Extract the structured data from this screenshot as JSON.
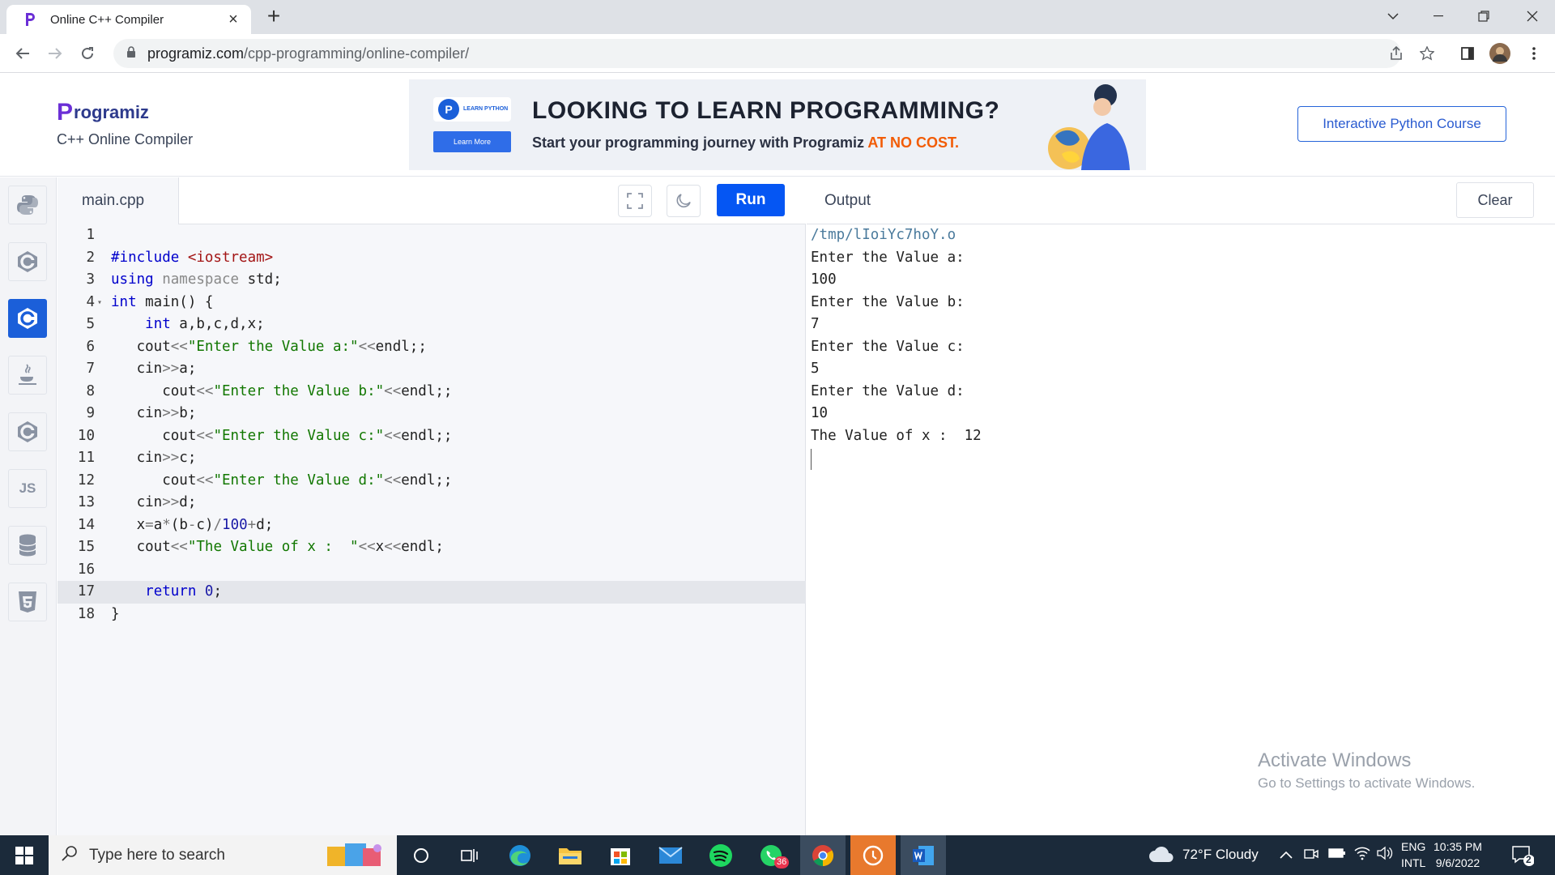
{
  "browser": {
    "tab_title": "Online C++ Compiler",
    "url_domain": "programiz.com",
    "url_path": "/cpp-programming/online-compiler/"
  },
  "header": {
    "logo_text": "rogramiz",
    "logo_mark": "P",
    "subtitle": "C++ Online Compiler",
    "banner": {
      "badge_text": "LEARN PYTHON",
      "learn_more": "Learn More",
      "headline": "LOOKING TO LEARN PROGRAMMING?",
      "sub_text": "Start your programming journey with Programiz ",
      "sub_highlight": "AT NO COST."
    },
    "course_button": "Interactive Python Course"
  },
  "rail": {
    "items": [
      {
        "name": "python",
        "icon": "python-icon"
      },
      {
        "name": "c",
        "icon": "c-icon",
        "glyph": "C"
      },
      {
        "name": "cpp",
        "icon": "cpp-icon",
        "glyph": "C",
        "active": true
      },
      {
        "name": "java",
        "icon": "java-icon",
        "glyph": "♨"
      },
      {
        "name": "csharp",
        "icon": "csharp-icon",
        "glyph": "C"
      },
      {
        "name": "javascript",
        "icon": "js-icon",
        "glyph": "JS"
      },
      {
        "name": "sql",
        "icon": "database-icon"
      },
      {
        "name": "html",
        "icon": "html5-icon",
        "glyph": "5"
      }
    ]
  },
  "editor": {
    "file_name": "main.cpp",
    "run_label": "Run",
    "current_line": 17,
    "lines": [
      {
        "n": "1",
        "code": ""
      },
      {
        "n": "2",
        "code": "#include <iostream>"
      },
      {
        "n": "3",
        "code": "using namespace std;"
      },
      {
        "n": "4",
        "code": "int main() {",
        "fold": "▾"
      },
      {
        "n": "5",
        "code": "    int a,b,c,d,x;"
      },
      {
        "n": "6",
        "code": "   cout<<\"Enter the Value a:\"<<endl;;"
      },
      {
        "n": "7",
        "code": "   cin>>a;"
      },
      {
        "n": "8",
        "code": "      cout<<\"Enter the Value b:\"<<endl;;"
      },
      {
        "n": "9",
        "code": "   cin>>b;"
      },
      {
        "n": "10",
        "code": "      cout<<\"Enter the Value c:\"<<endl;;"
      },
      {
        "n": "11",
        "code": "   cin>>c;"
      },
      {
        "n": "12",
        "code": "      cout<<\"Enter the Value d:\"<<endl;;"
      },
      {
        "n": "13",
        "code": "   cin>>d;"
      },
      {
        "n": "14",
        "code": "   x=a*(b-c)/100+d;"
      },
      {
        "n": "15",
        "code": "   cout<<\"The Value of x :  \"<<x<<endl;"
      },
      {
        "n": "16",
        "code": ""
      },
      {
        "n": "17",
        "code": "    return 0;"
      },
      {
        "n": "18",
        "code": "}"
      }
    ]
  },
  "output": {
    "title": "Output",
    "clear_label": "Clear",
    "lines": [
      "/tmp/lIoiYc7hoY.o",
      "Enter the Value a:",
      "100",
      "Enter the Value b:",
      "7",
      "Enter the Value c:",
      "5",
      "Enter the Value d:",
      "10",
      "The Value of x :  12"
    ],
    "watermark_title": "Activate Windows",
    "watermark_sub": "Go to Settings to activate Windows."
  },
  "taskbar": {
    "search_placeholder": "Type here to search",
    "weather": "72°F  Cloudy",
    "lang_top": "ENG",
    "lang_bottom": "INTL",
    "time": "10:35 PM",
    "date": "9/6/2022",
    "whatsapp_badge": "36",
    "notification_count": "2"
  },
  "colors": {
    "accent": "#0556f3",
    "keyword": "#0000cc",
    "string": "#117700",
    "taskbar": "#1b2a3a"
  }
}
